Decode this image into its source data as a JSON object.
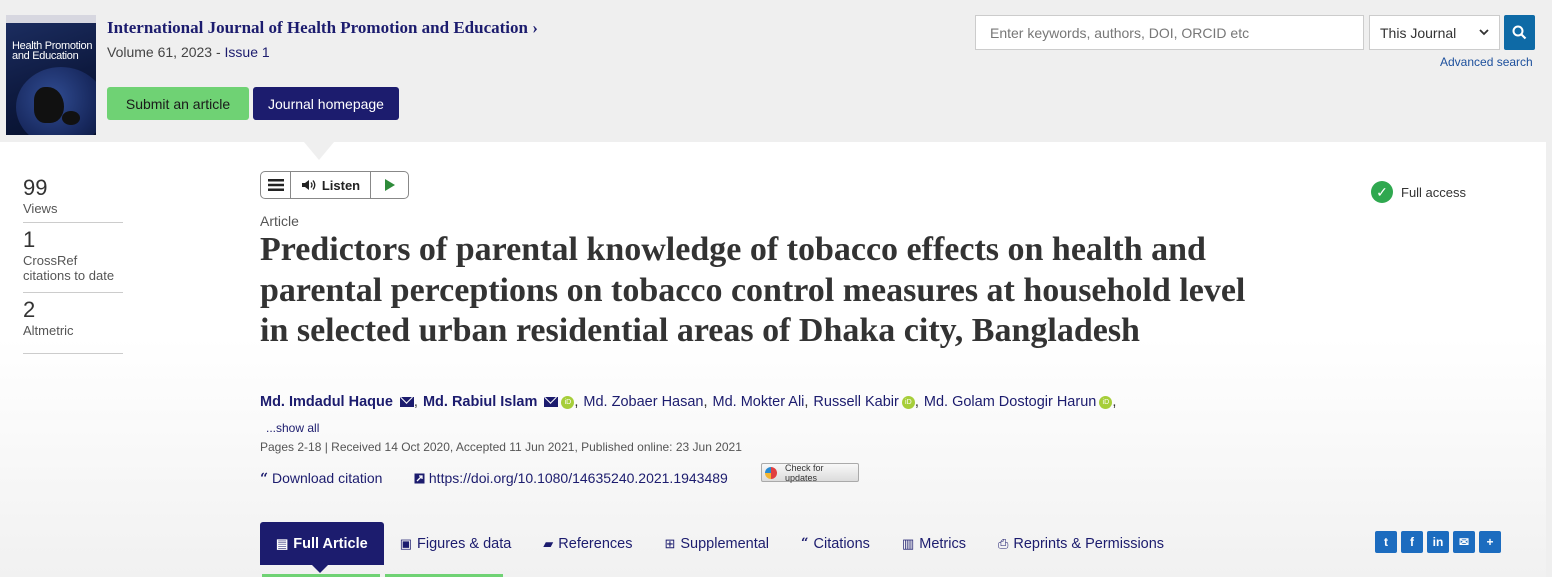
{
  "header": {
    "cover_title": "Health Promotion and Education",
    "journal_title": "International Journal of Health Promotion and Education",
    "journal_chevron": "›",
    "volume_text": "Volume 61, 2023 - ",
    "issue_link": "Issue 1",
    "submit_label": "Submit an article",
    "homepage_label": "Journal homepage"
  },
  "search": {
    "placeholder": "Enter keywords, authors, DOI, ORCID etc",
    "scope_selected": "This Journal",
    "advanced_label": "Advanced search"
  },
  "metrics": [
    {
      "value": "99",
      "label": "Views"
    },
    {
      "value": "1",
      "label": "CrossRef citations to date"
    },
    {
      "value": "2",
      "label": "Altmetric"
    }
  ],
  "listen": {
    "label": "Listen"
  },
  "article": {
    "type": "Article",
    "title": "Predictors of parental knowledge of tobacco effects on health and parental perceptions on tobacco control measures at household level in selected urban residential areas of Dhaka city, Bangladesh",
    "authors": [
      "Md. Imdadul Haque",
      "Md. Rabiul Islam",
      "Md. Zobaer Hasan",
      "Md. Mokter Ali",
      "Russell Kabir",
      "Md. Golam Dostogir Harun"
    ],
    "show_all": "...show all",
    "dates": "Pages 2-18 | Received 14 Oct 2020, Accepted 11 Jun 2021, Published online: 23 Jun 2021",
    "download_citation": "Download citation",
    "doi": "https://doi.org/10.1080/14635240.2021.1943489",
    "check_updates": "Check for updates",
    "access": "Full access"
  },
  "tabs": [
    {
      "label": "Full Article",
      "icon": "file-icon"
    },
    {
      "label": "Figures & data",
      "icon": "image-icon"
    },
    {
      "label": "References",
      "icon": "book-icon"
    },
    {
      "label": "Supplemental",
      "icon": "plus-square-icon"
    },
    {
      "label": "Citations",
      "icon": "quote-icon"
    },
    {
      "label": "Metrics",
      "icon": "bar-chart-icon"
    },
    {
      "label": "Reprints & Permissions",
      "icon": "print-icon"
    }
  ],
  "colors": {
    "brand_navy": "#1c1c6e",
    "accent_green": "#6fd274",
    "search_blue": "#0e6aa6",
    "orcid_green": "#a6ce39"
  }
}
